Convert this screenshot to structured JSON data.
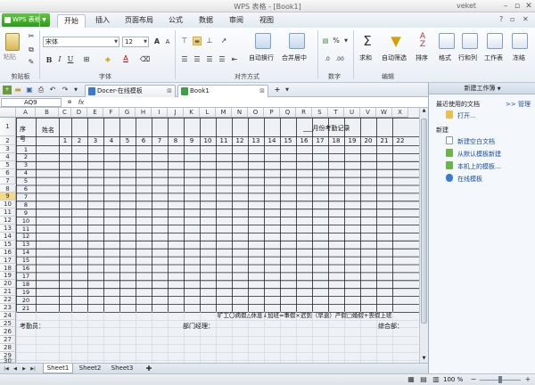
{
  "window": {
    "title": "WPS 表格 - [Book1]",
    "user": "veket"
  },
  "menu": {
    "app_button": "WPS 表格",
    "tabs": [
      "开始",
      "插入",
      "页面布局",
      "公式",
      "数据",
      "审阅",
      "视图"
    ]
  },
  "ribbon": {
    "groups": [
      "剪贴板",
      "字体",
      "对齐方式",
      "数字",
      "编辑"
    ],
    "paste": "粘贴",
    "font_name": "宋体",
    "font_size": "12",
    "percent": "%",
    "buttons": [
      "自动换行",
      "合并居中",
      "求和",
      "自动筛选",
      "排序",
      "格式",
      "行和列",
      "工作表",
      "冻结"
    ]
  },
  "doc_tabs": [
    {
      "label": "Docer-在线模板"
    },
    {
      "label": "Book1"
    }
  ],
  "name_box": "AQ9",
  "sheet": {
    "columns": [
      "A",
      "B",
      "C",
      "D",
      "E",
      "F",
      "G",
      "H",
      "I",
      "J",
      "K",
      "L",
      "M",
      "N",
      "O",
      "P",
      "Q",
      "R",
      "S",
      "T",
      "U",
      "V",
      "W",
      "X"
    ],
    "rows": [
      "1",
      "2",
      "3",
      "4",
      "5",
      "6",
      "7",
      "8",
      "9",
      "10",
      "11",
      "12",
      "13",
      "14",
      "15",
      "16",
      "17",
      "18",
      "19",
      "20",
      "21",
      "22",
      "23",
      "24",
      "25",
      "26",
      "27",
      "28",
      "29",
      "30"
    ],
    "selected_row": "9",
    "cells": {
      "seq_header": "序号",
      "name_header": "姓名",
      "title": "___月份考勤记录",
      "days": [
        "1",
        "2",
        "3",
        "4",
        "5",
        "6",
        "7",
        "8",
        "9",
        "10",
        "11",
        "12",
        "13",
        "14",
        "15",
        "16",
        "17",
        "18",
        "19",
        "20",
        "21",
        "22"
      ],
      "seq_numbers": [
        "1",
        "2",
        "3",
        "4",
        "5",
        "6",
        "7",
        "8",
        "9",
        "10",
        "11",
        "12",
        "13",
        "14",
        "15",
        "16",
        "17",
        "18",
        "19",
        "20",
        "21"
      ],
      "legend": "旷工〇病假△休息↓加班≈事假×迟到（早退）产假□婚假+丧假上班",
      "checker": "考勤员：",
      "manager": "部门经理：",
      "approver": "综合部："
    }
  },
  "sheet_tabs": [
    "Sheet1",
    "Sheet2",
    "Sheet3"
  ],
  "status": {
    "zoom": "100 %"
  },
  "taskpane": {
    "title": "新建工作簿",
    "recent_heading": "最近使用的文档",
    "manage": ">> 管理",
    "open": "打开...",
    "new_heading": "新建",
    "items": [
      "新建空白文档",
      "从默认模板新建",
      "本机上的模板...",
      "在线模板"
    ]
  },
  "colors": {
    "accent": "#2e9a1c",
    "selected_row": "#f5d98a",
    "link": "#1a4fa0"
  }
}
